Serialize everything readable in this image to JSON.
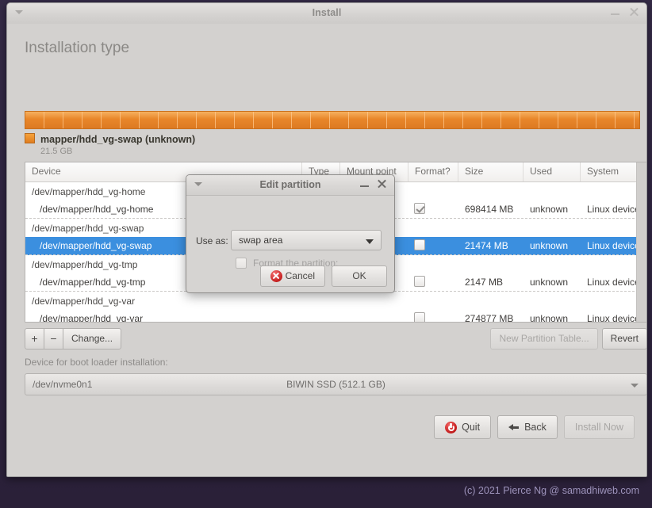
{
  "window": {
    "title": "Install",
    "minimize_label": "minimize",
    "close_label": "close"
  },
  "page": {
    "title": "Installation type"
  },
  "legend": {
    "name": "mapper/hdd_vg-swap (unknown)",
    "size": "21.5 GB",
    "color": "#e8862a"
  },
  "table": {
    "headers": {
      "device": "Device",
      "type": "Type",
      "mount": "Mount point",
      "format": "Format?",
      "size": "Size",
      "used": "Used",
      "system": "System"
    },
    "rows": [
      {
        "device": "/dev/mapper/hdd_vg-home",
        "type": "",
        "mount": "",
        "format": "",
        "size": "",
        "used": "",
        "system": "",
        "indent": false,
        "selected": false,
        "checked": false,
        "show_check": false
      },
      {
        "device": "/dev/mapper/hdd_vg-home",
        "type": "",
        "mount": "",
        "format": "",
        "size": "698414 MB",
        "used": "unknown",
        "system": "Linux device-ma",
        "indent": true,
        "selected": false,
        "checked": true,
        "show_check": true
      },
      {
        "device": "/dev/mapper/hdd_vg-swap",
        "type": "",
        "mount": "",
        "format": "",
        "size": "",
        "used": "",
        "system": "",
        "indent": false,
        "selected": false,
        "checked": false,
        "show_check": false
      },
      {
        "device": "/dev/mapper/hdd_vg-swap",
        "type": "",
        "mount": "",
        "format": "",
        "size": "21474 MB",
        "used": "unknown",
        "system": "Linux device-ma",
        "indent": true,
        "selected": true,
        "checked": false,
        "show_check": true
      },
      {
        "device": "/dev/mapper/hdd_vg-tmp",
        "type": "",
        "mount": "",
        "format": "",
        "size": "",
        "used": "",
        "system": "",
        "indent": false,
        "selected": false,
        "checked": false,
        "show_check": false
      },
      {
        "device": "/dev/mapper/hdd_vg-tmp",
        "type": "",
        "mount": "",
        "format": "",
        "size": "2147 MB",
        "used": "unknown",
        "system": "Linux device-ma",
        "indent": true,
        "selected": false,
        "checked": false,
        "show_check": true
      },
      {
        "device": "/dev/mapper/hdd_vg-var",
        "type": "",
        "mount": "",
        "format": "",
        "size": "",
        "used": "",
        "system": "",
        "indent": false,
        "selected": false,
        "checked": false,
        "show_check": false
      },
      {
        "device": "/dev/mapper/hdd_vg-var",
        "type": "",
        "mount": "",
        "format": "",
        "size": "274877 MB",
        "used": "unknown",
        "system": "Linux device-ma",
        "indent": true,
        "selected": false,
        "checked": false,
        "show_check": true
      }
    ]
  },
  "toolbar": {
    "add_label": "+",
    "remove_label": "−",
    "change_label": "Change...",
    "new_partition_table_label": "New Partition Table...",
    "revert_label": "Revert"
  },
  "bootloader": {
    "label": "Device for boot loader installation:",
    "device": "/dev/nvme0n1",
    "model": "BIWIN SSD (512.1 GB)"
  },
  "actions": {
    "quit_label": "Quit",
    "back_label": "Back",
    "install_label": "Install Now"
  },
  "progress": {
    "dots": [
      "on",
      "on",
      "on",
      "on",
      "on",
      "off",
      "off"
    ]
  },
  "footer": {
    "text": "(c) 2021 Pierce Ng @ samadhiweb.com"
  },
  "dialog": {
    "title": "Edit partition",
    "use_as_label": "Use as:",
    "use_as_value": "swap area",
    "format_label": "Format the partition:",
    "format_checked": false,
    "cancel_label": "Cancel",
    "ok_label": "OK"
  }
}
